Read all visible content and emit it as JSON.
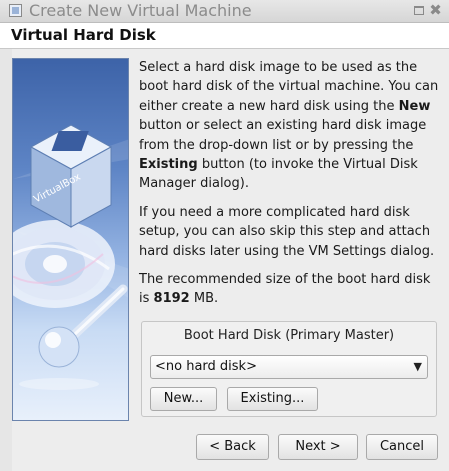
{
  "window": {
    "title": "Create New Virtual Machine"
  },
  "header": {
    "heading": "Virtual Hard Disk"
  },
  "side_image": {
    "logo_text": "VirtualBox"
  },
  "content": {
    "para1": {
      "t1": "Select a hard disk image to be used as the boot hard disk of the virtual machine. You can either create a new hard disk using the ",
      "b1": "New",
      "t2": " button or select an existing hard disk image from the drop-down list or by pressing the ",
      "b2": "Existing",
      "t3": " button (to invoke the Virtual Disk Manager dialog)."
    },
    "para2": "If you need a more complicated hard disk setup, you can also skip this step and attach hard disks later using the VM Settings dialog.",
    "para3": {
      "t1": "The recommended size of the boot hard disk is ",
      "size": "8192",
      "t2": " MB."
    }
  },
  "boot_disk": {
    "group_title": "Boot Hard Disk (Primary Master)",
    "selected": "<no hard disk>",
    "new_label": "New...",
    "existing_label": "Existing..."
  },
  "footer": {
    "back_label": "< Back",
    "next_label": "Next >",
    "cancel_label": "Cancel"
  }
}
